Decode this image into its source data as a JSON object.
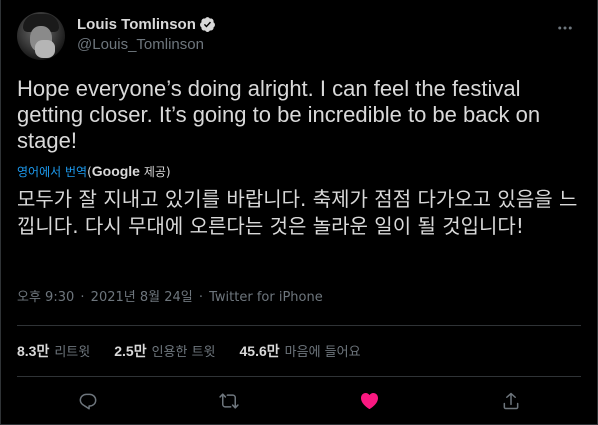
{
  "user": {
    "display_name": "Louis Tomlinson",
    "handle": "@Louis_Tomlinson",
    "verified": true
  },
  "tweet": {
    "text": "Hope everyone’s doing alright. I can feel the festival getting closer. It’s going to be incredible to be back on stage!",
    "translate_label": "영어에서 번역",
    "translate_paren_open": "(",
    "translate_provider": "Google",
    "translate_provided": "제공)",
    "translated_text": "모두가 잘 지내고 있기를 바랍니다. 축제가 점점 다가오고 있음을 느낍니다. 다시 무대에 오른다는 것은 놀라운 일이 될 것입니다!",
    "time": "오후 9:30",
    "separator": "·",
    "date": "2021년 8월 24일",
    "source": "Twitter for iPhone"
  },
  "stats": {
    "retweets_count": "8.3만",
    "retweets_label": "리트윗",
    "quotes_count": "2.5만",
    "quotes_label": "인용한 트윗",
    "likes_count": "45.6만",
    "likes_label": "마음에 들어요"
  },
  "colors": {
    "background": "#000000",
    "text": "#d9d9d9",
    "secondary": "#6e767d",
    "accent": "#1d9bf0",
    "like": "#f91880",
    "border": "#2f3336"
  },
  "icons": {
    "more": "more-horizontal-icon",
    "verified": "verified-badge-icon",
    "reply": "reply-icon",
    "retweet": "retweet-icon",
    "like": "heart-filled-icon",
    "share": "share-icon"
  }
}
